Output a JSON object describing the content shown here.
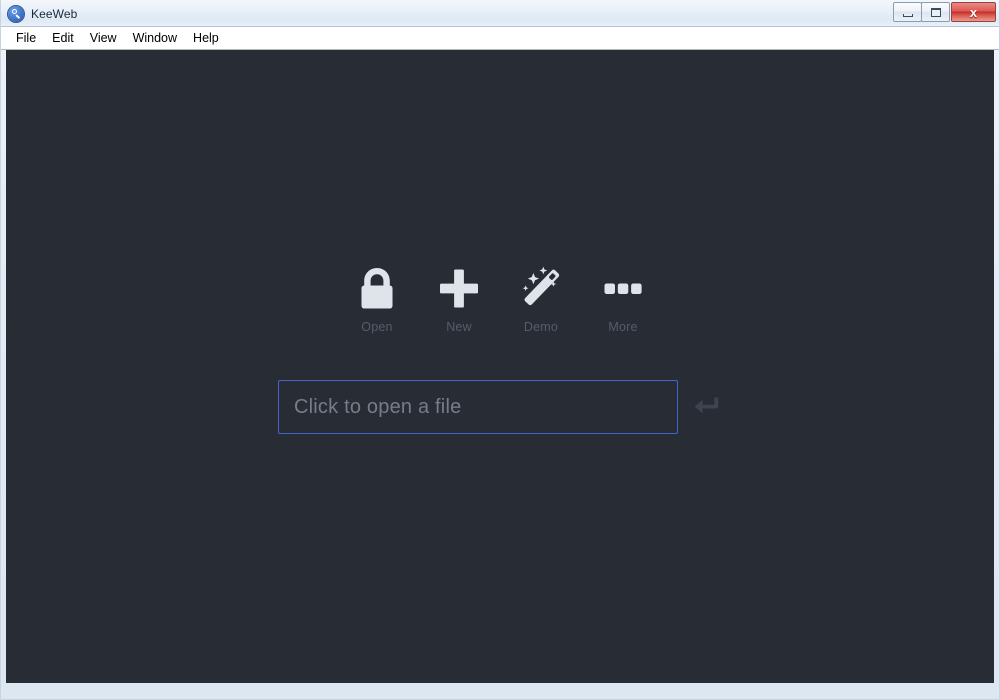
{
  "window": {
    "title": "KeeWeb",
    "app_icon": "keeweb-logo-icon",
    "controls": {
      "minimize_label": "",
      "maximize_label": "",
      "close_label": "x"
    },
    "colors": {
      "app_background": "#282c35",
      "accent_border": "#4465c8",
      "icon_fill": "#dfe3ea",
      "label_text": "#565c6b",
      "placeholder_text": "#767c8a",
      "titlebar_text": "#18293d",
      "close_button": "#c53029"
    }
  },
  "menubar": {
    "items": [
      {
        "label": "File"
      },
      {
        "label": "Edit"
      },
      {
        "label": "View"
      },
      {
        "label": "Window"
      },
      {
        "label": "Help"
      }
    ]
  },
  "intro": {
    "buttons": [
      {
        "label": "Open",
        "icon": "lock-icon"
      },
      {
        "label": "New",
        "icon": "plus-icon"
      },
      {
        "label": "Demo",
        "icon": "magic-wand-icon"
      },
      {
        "label": "More",
        "icon": "ellipsis-icon"
      }
    ],
    "file_input": {
      "placeholder": "Click to open a file",
      "value": ""
    },
    "enter_icon": "enter-return-icon"
  }
}
